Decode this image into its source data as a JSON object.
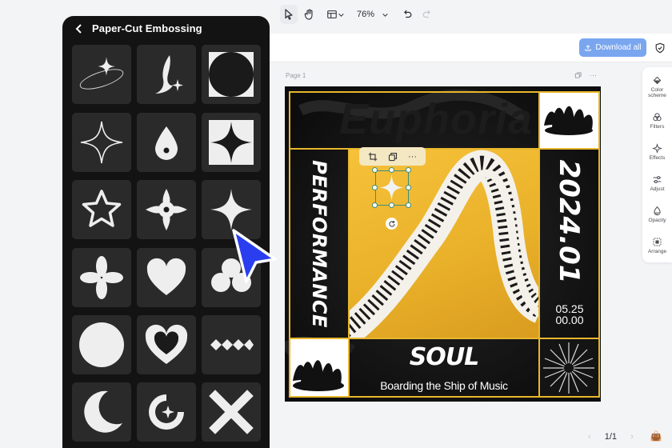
{
  "panel": {
    "title": "Paper-Cut Embossing",
    "shapes": [
      {
        "name": "sparkle-orbit"
      },
      {
        "name": "ribbon"
      },
      {
        "name": "circle-cutout"
      },
      {
        "name": "four-point-star-outline"
      },
      {
        "name": "droplet"
      },
      {
        "name": "four-point-star-cutout"
      },
      {
        "name": "star-outline"
      },
      {
        "name": "flower-diamond"
      },
      {
        "name": "four-point-star"
      },
      {
        "name": "clover"
      },
      {
        "name": "heart"
      },
      {
        "name": "club"
      },
      {
        "name": "circle"
      },
      {
        "name": "heart-outline"
      },
      {
        "name": "diamond-chain"
      },
      {
        "name": "crescent-moon"
      },
      {
        "name": "swirl-sparkle"
      },
      {
        "name": "x-cross"
      }
    ]
  },
  "toolbar": {
    "zoom": "76%",
    "download_label": "Download all"
  },
  "canvas": {
    "page_label": "Page 1",
    "page_more": "···"
  },
  "poster": {
    "background_word": "Euphoria",
    "side_text": "PERFORMANCE",
    "year": "2024.01",
    "date_line1": "05.25",
    "date_line2": "00.00",
    "headline": "SOUL",
    "tagline": "Boarding the Ship of Music",
    "accent_color": "#e8b72c"
  },
  "rail": {
    "items": [
      {
        "label_1": "Color",
        "label_2": "scheme"
      },
      {
        "label_1": "Filters",
        "label_2": ""
      },
      {
        "label_1": "Effects",
        "label_2": ""
      },
      {
        "label_1": "Adjust",
        "label_2": ""
      },
      {
        "label_1": "Opacity",
        "label_2": ""
      },
      {
        "label_1": "Arrange",
        "label_2": ""
      }
    ]
  },
  "footer": {
    "page_count": "1/1"
  },
  "context_menu": {
    "more": "···"
  }
}
